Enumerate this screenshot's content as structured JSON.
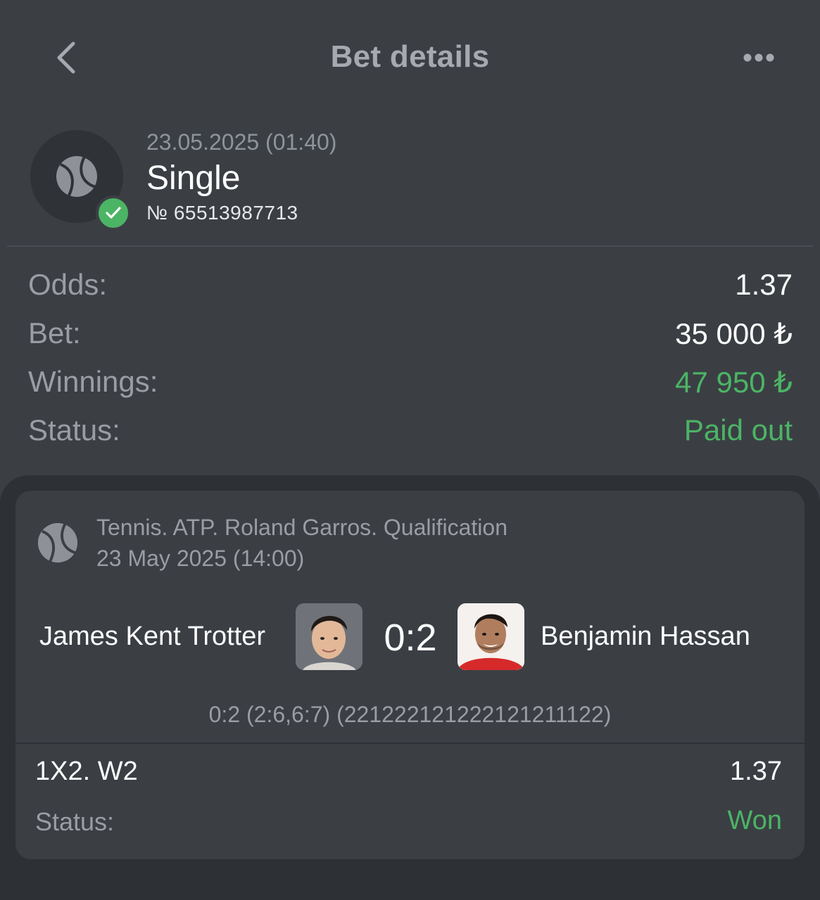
{
  "header": {
    "title": "Bet details",
    "back_icon": "chevron-left-icon",
    "more_icon": "more-horizontal-icon"
  },
  "bet": {
    "date": "23.05.2025 (01:40)",
    "type": "Single",
    "number": "№ 65513987713",
    "sport_icon": "tennis-ball-icon",
    "status_icon": "check-circle-icon"
  },
  "summary": {
    "odds_label": "Odds:",
    "odds_value": "1.37",
    "bet_label": "Bet:",
    "bet_value": "35 000 ₺",
    "winnings_label": "Winnings:",
    "winnings_value": "47 950 ₺",
    "status_label": "Status:",
    "status_value": "Paid out"
  },
  "event": {
    "league": "Tennis. ATP. Roland Garros. Qualification",
    "date": "23 May 2025 (14:00)",
    "team1": "James Kent Trotter",
    "team2": "Benjamin Hassan",
    "score": "0:2",
    "score_details": "0:2 (2:6,6:7) (221222121222121211122)",
    "market": "1X2. W2",
    "market_odds": "1.37",
    "status_label": "Status:",
    "status_value": "Won"
  },
  "colors": {
    "background": "#3b3f44",
    "panel": "#2d3034",
    "green": "#4cb465",
    "muted": "#9a9ea4"
  }
}
